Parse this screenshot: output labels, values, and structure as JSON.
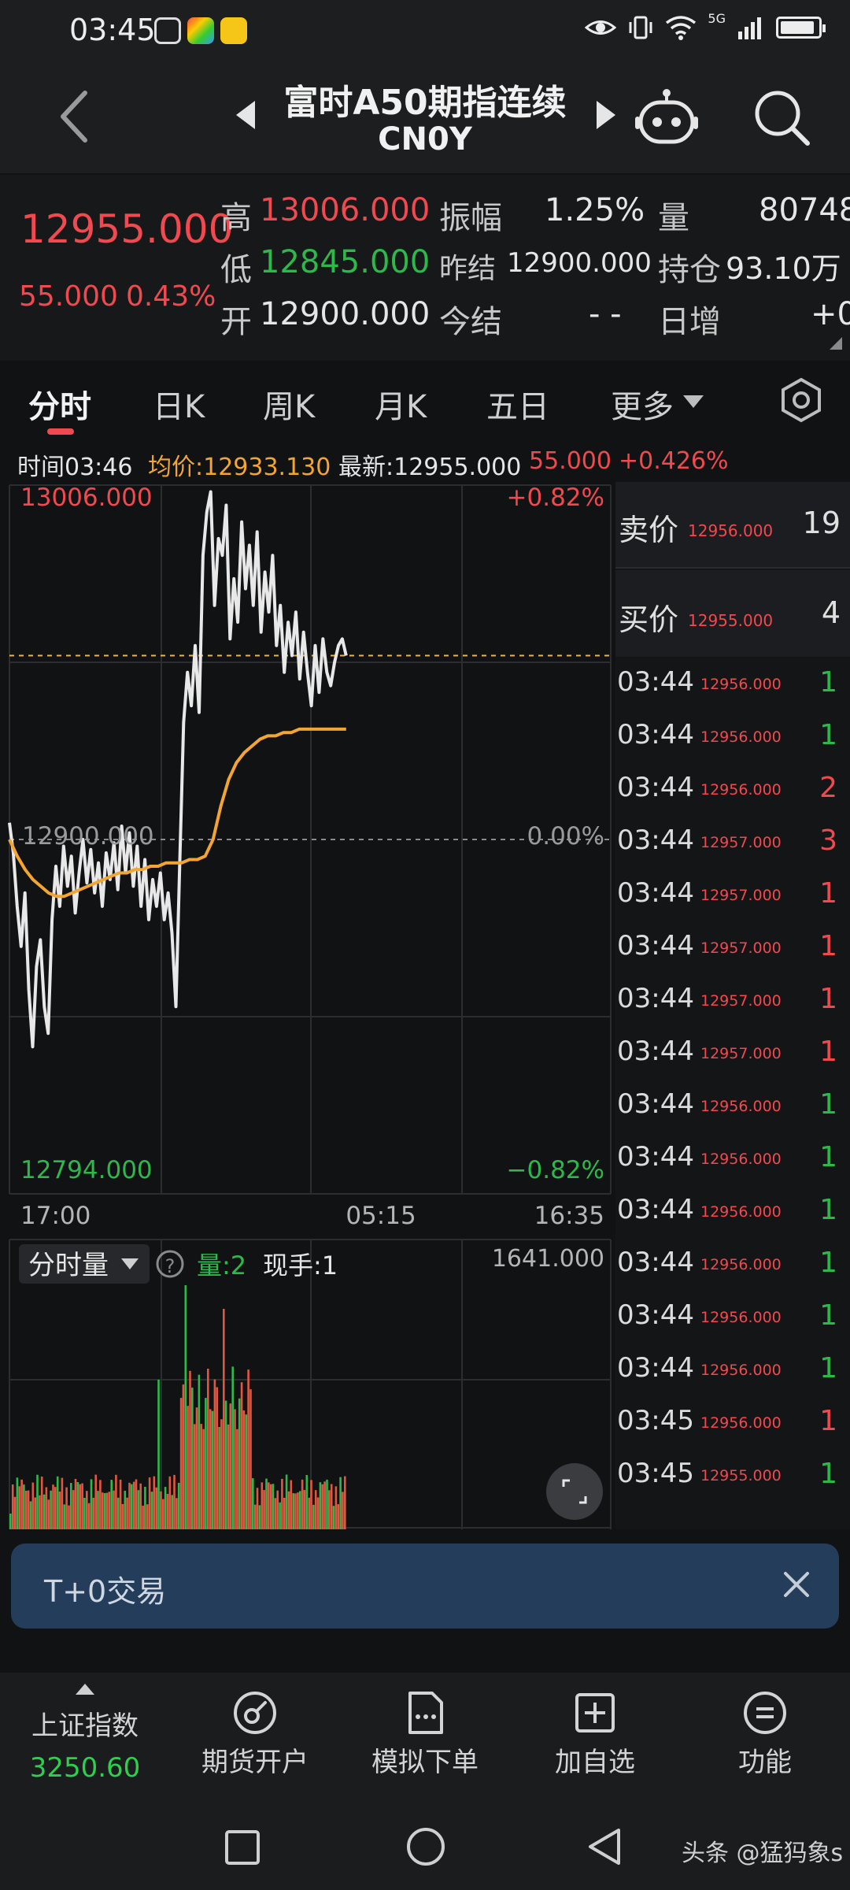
{
  "status_bar": {
    "time": "03:45",
    "network": "5G"
  },
  "header": {
    "title": "富时A50期指连续",
    "subtitle": "CN0Y"
  },
  "quote": {
    "last_price": "12955.000",
    "change": "55.000",
    "change_pct": "0.43%",
    "high_label": "高",
    "high": "13006.000",
    "low_label": "低",
    "low": "12845.000",
    "open_label": "开",
    "open": "12900.000",
    "amplitude_label": "振幅",
    "amplitude": "1.25%",
    "prev_settle_label": "昨结",
    "prev_settle": "12900.000",
    "settle_label": "今结",
    "settle": "- -",
    "volume_label": "量",
    "volume": "80748",
    "open_interest_label": "持仓",
    "open_interest": "93.10万",
    "daily_inc_label": "日增",
    "daily_inc": "+0"
  },
  "tabs": [
    "分时",
    "日K",
    "周K",
    "月K",
    "五日",
    "更多"
  ],
  "info_row": {
    "time_label": "时间03:46",
    "avg_label": "均价:12933.130",
    "latest_label": "最新:12955.000",
    "change": "55.000",
    "change_pct": "+0.426%"
  },
  "chart": {
    "y_max_label": "13006.000",
    "y_mid_label": "12900.000",
    "y_min_label": "12794.000",
    "pct_max_label": "+0.82%",
    "pct_mid_label": "0.00%",
    "pct_min_label": "−0.82%",
    "x_labels": [
      "17:00",
      "05:15",
      "16:35"
    ],
    "volume_selector": "分时量",
    "volume_qty_label": "量:2",
    "current_hand_label": "现手:1",
    "volume_max_label": "1641.000"
  },
  "chart_data": {
    "type": "line",
    "title": "",
    "xlabel": "",
    "ylabel": "",
    "ylim": [
      12794,
      13006
    ],
    "x_ticks": [
      "17:00",
      "05:15",
      "16:35"
    ],
    "session_progress": 0.56,
    "series": [
      {
        "values": [
          12905,
          12896,
          12880,
          12868,
          12884,
          12855,
          12838,
          12862,
          12870,
          12850,
          12842,
          12876,
          12892,
          12880,
          12898,
          12886,
          12895,
          12878,
          12890,
          12900,
          12887,
          12897,
          12884,
          12893,
          12880,
          12896,
          12888,
          12899,
          12885,
          12904,
          12890,
          12902,
          12886,
          12898,
          12880,
          12894,
          12876,
          12888,
          12880,
          12890,
          12876,
          12884,
          12872,
          12850,
          12893,
          12935,
          12950,
          12940,
          12958,
          12938,
          12985,
          12998,
          13004,
          12970,
          12990,
          12985,
          13000,
          12960,
          12978,
          12965,
          12995,
          12975,
          12988,
          12970,
          12992,
          12962,
          12980,
          12968,
          12985,
          12958,
          12970,
          12950,
          12965,
          12955,
          12968,
          12948,
          12962,
          12950,
          12940,
          12958,
          12944,
          12960,
          12950,
          12946,
          12953,
          12958,
          12960,
          12955
        ]
      },
      {
        "values": [
          12900,
          12895,
          12891,
          12888,
          12886,
          12884,
          12883,
          12883,
          12884,
          12885,
          12886,
          12887,
          12888,
          12889,
          12890,
          12890,
          12891,
          12891,
          12892,
          12892,
          12893,
          12893,
          12893,
          12894,
          12894,
          12895,
          12900,
          12910,
          12918,
          12923,
          12926,
          12928,
          12930,
          12931,
          12931,
          12932,
          12932,
          12933,
          12933,
          12933,
          12933,
          12933,
          12933,
          12933
        ]
      }
    ],
    "volume_max": 1641
  },
  "order_book": {
    "ask_label": "卖价",
    "ask_price": "12956.000",
    "ask_qty": "19",
    "bid_label": "买价",
    "bid_price": "12955.000",
    "bid_qty": "4",
    "trades": [
      {
        "time": "03:44",
        "price": "12956.000",
        "qty": "1",
        "side": "green"
      },
      {
        "time": "03:44",
        "price": "12956.000",
        "qty": "1",
        "side": "green"
      },
      {
        "time": "03:44",
        "price": "12956.000",
        "qty": "2",
        "side": "red"
      },
      {
        "time": "03:44",
        "price": "12957.000",
        "qty": "3",
        "side": "red"
      },
      {
        "time": "03:44",
        "price": "12957.000",
        "qty": "1",
        "side": "red"
      },
      {
        "time": "03:44",
        "price": "12957.000",
        "qty": "1",
        "side": "red"
      },
      {
        "time": "03:44",
        "price": "12957.000",
        "qty": "1",
        "side": "red"
      },
      {
        "time": "03:44",
        "price": "12957.000",
        "qty": "1",
        "side": "red"
      },
      {
        "time": "03:44",
        "price": "12956.000",
        "qty": "1",
        "side": "green"
      },
      {
        "time": "03:44",
        "price": "12956.000",
        "qty": "1",
        "side": "green"
      },
      {
        "time": "03:44",
        "price": "12956.000",
        "qty": "1",
        "side": "green"
      },
      {
        "time": "03:44",
        "price": "12956.000",
        "qty": "1",
        "side": "green"
      },
      {
        "time": "03:44",
        "price": "12956.000",
        "qty": "1",
        "side": "green"
      },
      {
        "time": "03:44",
        "price": "12956.000",
        "qty": "1",
        "side": "green"
      },
      {
        "time": "03:45",
        "price": "12956.000",
        "qty": "1",
        "side": "red"
      },
      {
        "time": "03:45",
        "price": "12955.000",
        "qty": "1",
        "side": "green"
      }
    ]
  },
  "banner": {
    "text": "T+0交易"
  },
  "bottom_nav": {
    "index_name": "上证指数",
    "index_value": "3250.60",
    "items": [
      "期货开户",
      "模拟下单",
      "加自选",
      "功能"
    ]
  },
  "watermark": "头条 @猛犸象s",
  "colors": {
    "up": "#f0494f",
    "down": "#2db84b",
    "avg_line": "#f2a531",
    "banner": "#233d5a"
  }
}
